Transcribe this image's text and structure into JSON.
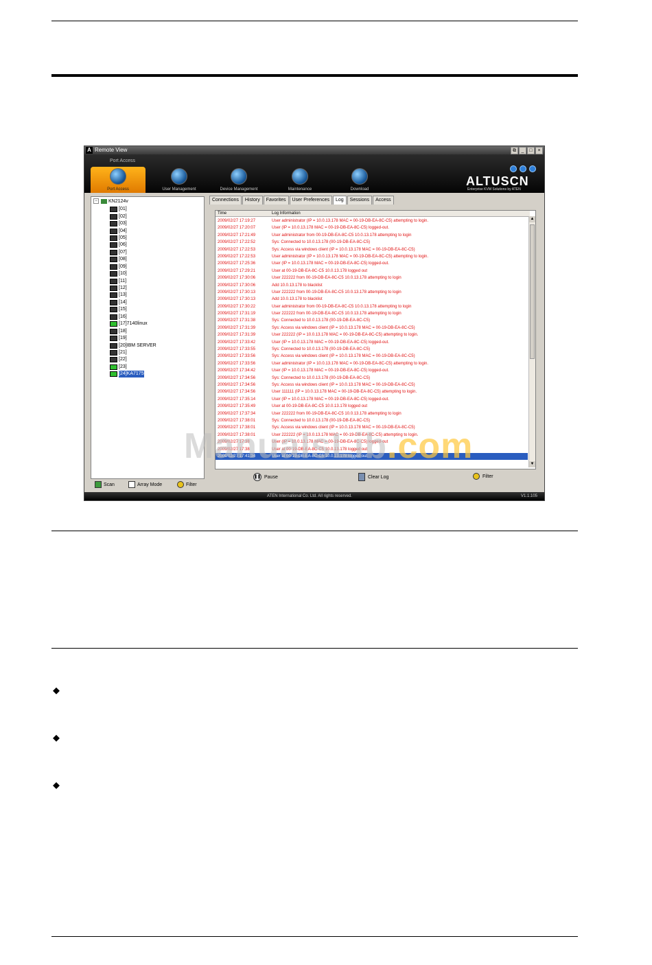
{
  "window": {
    "title": "Remote View",
    "breadcrumb": "Port Access",
    "brand": "ALTUSCN",
    "tagline": "Enterprise KVM Solutions by ATEN",
    "copyright": "ATEN International Co. Ltd. All rights reserved.",
    "version": "V1.1.105"
  },
  "main_tabs": [
    {
      "label": "Port Access",
      "active": true
    },
    {
      "label": "User Management"
    },
    {
      "label": "Device Management"
    },
    {
      "label": "Maintenance"
    },
    {
      "label": "Download"
    }
  ],
  "tree": {
    "root": "KN2124v",
    "items": [
      {
        "label": "[01]"
      },
      {
        "label": "[02]"
      },
      {
        "label": "[03]"
      },
      {
        "label": "[04]"
      },
      {
        "label": "[05]"
      },
      {
        "label": "[06]"
      },
      {
        "label": "[07]"
      },
      {
        "label": "[08]"
      },
      {
        "label": "[09]"
      },
      {
        "label": "[10]"
      },
      {
        "label": "[11]"
      },
      {
        "label": "[12]"
      },
      {
        "label": "[13]"
      },
      {
        "label": "[14]"
      },
      {
        "label": "[15]"
      },
      {
        "label": "[16]"
      },
      {
        "label": "[17]7140linux",
        "online": true
      },
      {
        "label": "[18]"
      },
      {
        "label": "[19]"
      },
      {
        "label": "[20]IBM SERVER"
      },
      {
        "label": "[21]"
      },
      {
        "label": "[22]"
      },
      {
        "label": "[23]",
        "online": true
      },
      {
        "label": "[24]KA7175",
        "online": true,
        "selected": true
      }
    ]
  },
  "left_buttons": {
    "scan": "Scan",
    "array_mode": "Array Mode",
    "filter": "Filter"
  },
  "sub_tabs": [
    "Connections",
    "History",
    "Favorites",
    "User Preferences",
    "Log",
    "Sessions",
    "Access"
  ],
  "log": {
    "col_time": "Time",
    "col_info": "Log Information",
    "rows": [
      {
        "time": "2009/02/27 17:19:27",
        "info": "User administrator (IP = 10.0.13.178 MAC = 00-19-DB-EA-8C-C5) attempting to login."
      },
      {
        "time": "2009/02/27 17:20:07",
        "info": "User (IP = 10.0.13.178 MAC = 00-19-DB-EA-8C-C5) logged-out."
      },
      {
        "time": "2009/02/27 17:21:49",
        "info": "User administrator from 00-19-DB-EA-8C-C5 10.0.13.178 attempting to login"
      },
      {
        "time": "2009/02/27 17:22:52",
        "info": "Sys: Connected to 10.0.13.178 (00-19-DB-EA-8C-C5)"
      },
      {
        "time": "2009/02/27 17:22:53",
        "info": "Sys: Access via windows client (IP = 10.0.13.178 MAC = 00-19-DB-EA-8C-C5)"
      },
      {
        "time": "2009/02/27 17:22:53",
        "info": "User administrator (IP = 10.0.13.178 MAC = 00-19-DB-EA-8C-C5) attempting to login."
      },
      {
        "time": "2009/02/27 17:25:36",
        "info": "User (IP = 10.0.13.178 MAC = 00-19-DB-EA-8C-C5) logged-out."
      },
      {
        "time": "2009/02/27 17:29:21",
        "info": "User at 00-19-DB-EA-8C-C5 10.0.13.178 logged out"
      },
      {
        "time": "2009/02/27 17:30:06",
        "info": "User 222222 from 00-19-DB-EA-8C-C5 10.0.13.178 attempting to login"
      },
      {
        "time": "2009/02/27 17:30:06",
        "info": "Add 10.0.13.178 to blacklist"
      },
      {
        "time": "2009/02/27 17:30:13",
        "info": "User 222222 from 00-19-DB-EA-8C-C5 10.0.13.178 attempting to login"
      },
      {
        "time": "2009/02/27 17:30:13",
        "info": "Add 10.0.13.178 to blacklist"
      },
      {
        "time": "2009/02/27 17:30:22",
        "info": "User administrator from 00-19-DB-EA-8C-C5 10.0.13.178 attempting to login"
      },
      {
        "time": "2009/02/27 17:31:19",
        "info": "User 222222 from 00-19-DB-EA-8C-C5 10.0.13.178 attempting to login"
      },
      {
        "time": "2009/02/27 17:31:38",
        "info": "Sys: Connected to 10.0.13.178 (00-19-DB-EA-8C-C5)"
      },
      {
        "time": "2009/02/27 17:31:39",
        "info": "Sys: Access via windows client (IP = 10.0.13.178 MAC = 00-19-DB-EA-8C-C5)"
      },
      {
        "time": "2009/02/27 17:31:39",
        "info": "User 222222 (IP = 10.0.13.178 MAC = 00-19-DB-EA-8C-C5) attempting to login."
      },
      {
        "time": "2009/02/27 17:33:42",
        "info": "User (IP = 10.0.13.178 MAC = 00-19-DB-EA-8C-C5) logged-out."
      },
      {
        "time": "2009/02/27 17:33:55",
        "info": "Sys: Connected to 10.0.13.178 (00-19-DB-EA-8C-C5)"
      },
      {
        "time": "2009/02/27 17:33:56",
        "info": "Sys: Access via windows client (IP = 10.0.13.178 MAC = 00-19-DB-EA-8C-C5)"
      },
      {
        "time": "2009/02/27 17:33:56",
        "info": "User administrator (IP = 10.0.13.178 MAC = 00-19-DB-EA-8C-C5) attempting to login."
      },
      {
        "time": "2009/02/27 17:34:42",
        "info": "User (IP = 10.0.13.178 MAC = 00-19-DB-EA-8C-C5) logged-out."
      },
      {
        "time": "2009/02/27 17:34:56",
        "info": "Sys: Connected to 10.0.13.178 (00-19-DB-EA-8C-C5)"
      },
      {
        "time": "2009/02/27 17:34:56",
        "info": "Sys: Access via windows client (IP = 10.0.13.178 MAC = 00-19-DB-EA-8C-C5)"
      },
      {
        "time": "2009/02/27 17:34:56",
        "info": "User 111111 (IP = 10.0.13.178 MAC = 00-19-DB-EA-8C-C5) attempting to login."
      },
      {
        "time": "2009/02/27 17:35:14",
        "info": "User (IP = 10.0.13.178 MAC = 00-19-DB-EA-8C-C5) logged-out."
      },
      {
        "time": "2009/02/27 17:35:49",
        "info": "User at 00-19-DB-EA-8C-C5 10.0.13.178 logged out"
      },
      {
        "time": "2009/02/27 17:37:34",
        "info": "User 222222 from 00-19-DB-EA-8C-C5 10.0.13.178 attempting to login"
      },
      {
        "time": "2009/02/27 17:38:01",
        "info": "Sys: Connected to 10.0.13.178 (00-19-DB-EA-8C-C5)"
      },
      {
        "time": "2009/02/27 17:38:01",
        "info": "Sys: Access via windows client (IP = 10.0.13.178 MAC = 00-19-DB-EA-8C-C5)"
      },
      {
        "time": "2009/02/27 17:38:01",
        "info": "User 222222 (IP = 10.0.13.178 MAC = 00-19-DB-EA-8C-C5) attempting to login."
      },
      {
        "time": "2009/02/27 17:38",
        "info": "User (IP = 10.0.13.178 MAC = 00-19-DB-EA-8C-C5) logged-out"
      },
      {
        "time": "2009/02/27 17:38",
        "info": "User at 00-19-DB-EA-8C-C5 10.0.13.178 logged out"
      },
      {
        "time": "2009/02/27 17:41:34",
        "info": "User at 00-19-DB-EA-8C-C5 10.0.13.178 logged out",
        "selected": true
      }
    ]
  },
  "log_buttons": {
    "pause": "Pause",
    "clear": "Clear Log",
    "filter": "Filter"
  },
  "watermark": {
    "left": "ManualsLib",
    "right": ".com"
  },
  "colors": {
    "log_text": "#e01010",
    "selection": "#2a5dbf",
    "active_tab": "#f59a0c"
  }
}
